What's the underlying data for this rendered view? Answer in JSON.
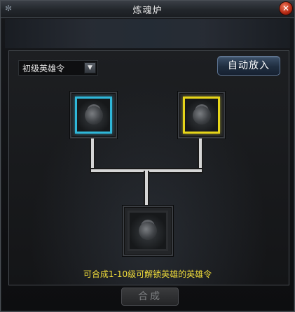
{
  "window": {
    "title": "炼魂炉",
    "close_icon": "close-icon"
  },
  "dropdown": {
    "selected": "初级英雄令",
    "arrow_icon": "chevron-down-icon"
  },
  "buttons": {
    "auto_place": "自动放入",
    "combine": "合成"
  },
  "slots": {
    "left": {
      "frame_color": "#2fb7d9",
      "icon": "item-pouch-icon"
    },
    "right": {
      "frame_color": "#e6d419",
      "icon": "item-pouch-icon"
    },
    "result": {
      "frame_color": "#2b2d30",
      "icon": "item-pouch-icon"
    }
  },
  "hint_text": "可合成1-10级可解锁英雄的英雄令",
  "colors": {
    "hint": "#f0dc3a",
    "close": "#c9371b",
    "auto_button": "#2a3a50"
  }
}
